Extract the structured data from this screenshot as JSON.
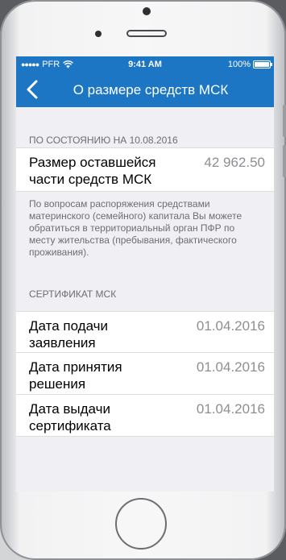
{
  "status_bar": {
    "signal": "●●●●●",
    "carrier": "PFR",
    "wifi_icon": "wifi-icon",
    "time": "9:41 AM",
    "battery": "100%"
  },
  "nav": {
    "title": "О размере средств МСК",
    "back_icon": "chevron-left-icon"
  },
  "balance_section": {
    "header": "ПО СОСТОЯНИЮ НА 10.08.2016",
    "row": {
      "label_line1": "Размер оставшейся",
      "label_line2": "части средств МСК",
      "value": "42 962.50"
    },
    "note": "По вопросам распоряжения средствами материнского (семейного) капитала Вы можете обратиться в территориальный орган ПФР по месту жительства (пребывания, фактического проживания)."
  },
  "certificate_section": {
    "header": "СЕРТИФИКАТ МСК",
    "rows": [
      {
        "label_line1": "Дата подачи",
        "label_line2": "заявления",
        "value": "01.04.2016"
      },
      {
        "label_line1": "Дата принятия",
        "label_line2": "решения",
        "value": "01.04.2016"
      },
      {
        "label_line1": "Дата выдачи",
        "label_line2": "сертификата",
        "value": "01.04.2016"
      }
    ]
  },
  "colors": {
    "accent": "#1c76c4",
    "background": "#efeff4",
    "secondary_text": "#8e8e93"
  }
}
